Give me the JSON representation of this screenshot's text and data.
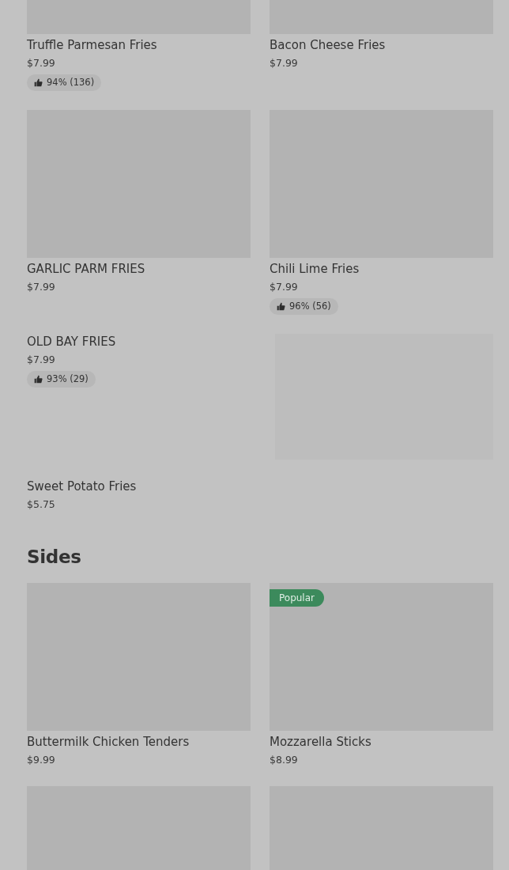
{
  "sections": [
    {
      "items": [
        {
          "kind": "product",
          "name": "Truffle Parmesan Fries",
          "price": "$7.99",
          "rating": "94% (136)"
        },
        {
          "kind": "product",
          "name": "Bacon Cheese Fries",
          "price": "$7.99"
        },
        {
          "kind": "product",
          "name": "GARLIC PARM FRIES",
          "price": "$7.99"
        },
        {
          "kind": "product",
          "name": "Chili Lime Fries",
          "price": "$7.99",
          "rating": "96% (56)"
        },
        {
          "kind": "textonly",
          "name": "OLD BAY FRIES",
          "price": "$7.99",
          "rating": "93% (29)"
        },
        {
          "kind": "placeholder"
        },
        {
          "kind": "textonly",
          "name": "Sweet Potato Fries",
          "price": "$5.75"
        }
      ]
    },
    {
      "title": "Sides",
      "items": [
        {
          "kind": "product",
          "name": "Buttermilk Chicken Tenders",
          "price": "$9.99"
        },
        {
          "kind": "product",
          "name": "Mozzarella Sticks",
          "price": "$8.99",
          "badge": "Popular"
        },
        {
          "kind": "product"
        },
        {
          "kind": "product"
        }
      ]
    }
  ]
}
